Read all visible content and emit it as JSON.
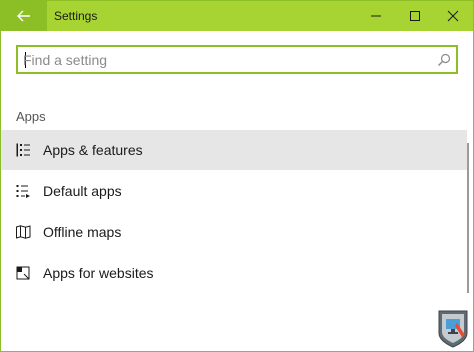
{
  "window": {
    "title": "Settings",
    "accent_color": "#a7d432",
    "back_button_color": "#8cbf26"
  },
  "titlebar": {
    "back_icon": "arrow-left-icon",
    "minimize_icon": "minimize-icon",
    "maximize_icon": "maximize-icon",
    "close_icon": "close-icon"
  },
  "search": {
    "placeholder": "Find a setting",
    "value": "",
    "icon": "search-icon"
  },
  "section": {
    "title": "Apps"
  },
  "nav": {
    "items": [
      {
        "label": "Apps & features",
        "icon": "apps-features-list-icon",
        "selected": true
      },
      {
        "label": "Default apps",
        "icon": "default-apps-list-icon",
        "selected": false
      },
      {
        "label": "Offline maps",
        "icon": "map-icon",
        "selected": false
      },
      {
        "label": "Apps for websites",
        "icon": "apps-for-websites-icon",
        "selected": false
      }
    ]
  },
  "watermark": {
    "icon": "windows-pc-logo-icon"
  }
}
